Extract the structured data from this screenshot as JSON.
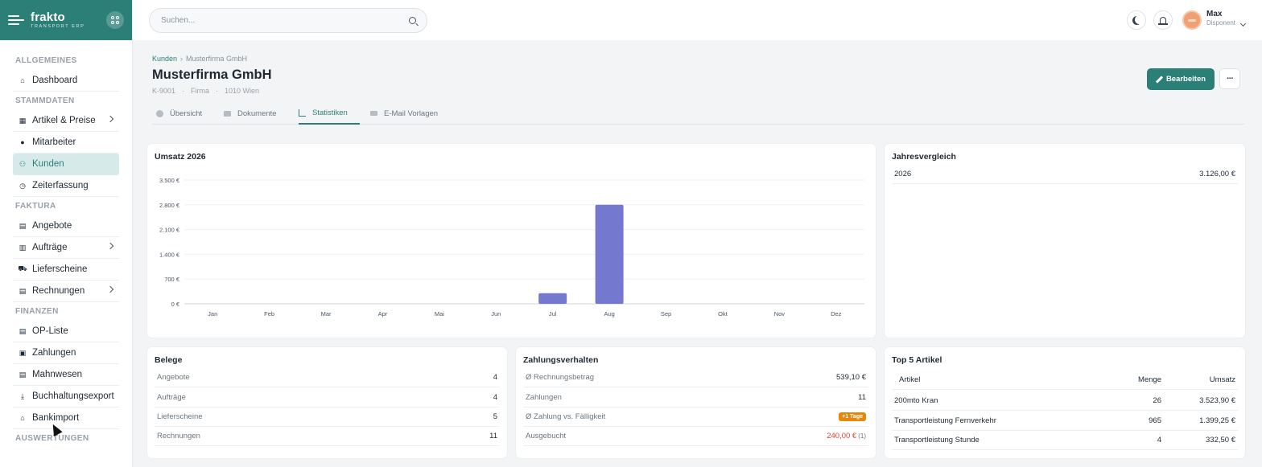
{
  "brand": {
    "name": "frakto",
    "tagline": "TRANSPORT ERP"
  },
  "sidebar": {
    "sections": [
      {
        "title": "ALLGEMEINES",
        "items": [
          {
            "label": "Dashboard",
            "icon": "home-icon"
          }
        ]
      },
      {
        "title": "STAMMDATEN",
        "items": [
          {
            "label": "Artikel & Preise",
            "icon": "boxes-icon",
            "chevron": true
          },
          {
            "label": "Mitarbeiter",
            "icon": "user-icon"
          },
          {
            "label": "Kunden",
            "icon": "users-icon",
            "active": true
          },
          {
            "label": "Zeiterfassung",
            "icon": "clock-icon"
          }
        ]
      },
      {
        "title": "FAKTURA",
        "items": [
          {
            "label": "Angebote",
            "icon": "file-icon"
          },
          {
            "label": "Aufträge",
            "icon": "clipboard-icon",
            "chevron": true
          },
          {
            "label": "Lieferscheine",
            "icon": "truck-icon"
          },
          {
            "label": "Rechnungen",
            "icon": "invoice-icon",
            "chevron": true
          }
        ]
      },
      {
        "title": "FINANZEN",
        "items": [
          {
            "label": "OP-Liste",
            "icon": "list-icon"
          },
          {
            "label": "Zahlungen",
            "icon": "money-icon"
          },
          {
            "label": "Mahnwesen",
            "icon": "file-warning-icon"
          },
          {
            "label": "Buchhaltungsexport",
            "icon": "download-icon"
          },
          {
            "label": "Bankimport",
            "icon": "bank-icon"
          }
        ]
      },
      {
        "title": "AUSWERTUNGEN",
        "items": []
      }
    ]
  },
  "topbar": {
    "search_placeholder": "Suchen...",
    "user_name": "Max",
    "user_role": "Disponent"
  },
  "breadcrumb": {
    "parent": "Kunden",
    "current": "Musterfirma GmbH"
  },
  "page": {
    "title": "Musterfirma GmbH",
    "customer_no": "K-9001",
    "type": "Firma",
    "location": "1010 Wien",
    "edit_label": "Bearbeiten",
    "more_label": "···"
  },
  "tabs": [
    {
      "label": "Übersicht",
      "icon": "info-icon"
    },
    {
      "label": "Dokumente",
      "icon": "folder-icon"
    },
    {
      "label": "Statistiken",
      "icon": "chart-icon",
      "active": true
    },
    {
      "label": "E-Mail Vorlagen",
      "icon": "mail-icon"
    }
  ],
  "revenue_card": {
    "title": "Umsatz 2026"
  },
  "chart_data": {
    "type": "bar",
    "title": "Umsatz 2026",
    "categories": [
      "Jan",
      "Feb",
      "Mar",
      "Apr",
      "Mai",
      "Jun",
      "Jul",
      "Aug",
      "Sep",
      "Okt",
      "Nov",
      "Dez"
    ],
    "values": [
      0,
      0,
      0,
      0,
      0,
      0,
      300,
      2800,
      0,
      0,
      0,
      0
    ],
    "yticks": [
      0,
      700,
      1400,
      2100,
      2800,
      3500
    ],
    "ytick_labels": [
      "0 €",
      "700 €",
      "1.400 €",
      "2.100 €",
      "2.800 €",
      "3.500 €"
    ],
    "ylim": [
      0,
      3500
    ],
    "xlabel": "",
    "ylabel": "",
    "grid": true,
    "bar_color": "#7479cf"
  },
  "year_compare": {
    "title": "Jahresvergleich",
    "rows": [
      {
        "year": "2026",
        "value": "3.126,00 €"
      }
    ]
  },
  "belege": {
    "title": "Belege",
    "rows": [
      {
        "label": "Angebote",
        "value": "4"
      },
      {
        "label": "Aufträge",
        "value": "4"
      },
      {
        "label": "Lieferscheine",
        "value": "5"
      },
      {
        "label": "Rechnungen",
        "value": "11"
      }
    ]
  },
  "payment": {
    "title": "Zahlungsverhalten",
    "avg_invoice_label": "Ø Rechnungsbetrag",
    "avg_invoice_value": "539,10 €",
    "payments_label": "Zahlungen",
    "payments_value": "11",
    "avg_delay_label": "Ø Zahlung vs. Fälligkeit",
    "avg_delay_badge": "+1 Tage",
    "outstanding_label": "Ausgebucht",
    "outstanding_value": "240,00 €",
    "outstanding_count": "(1)"
  },
  "top_articles": {
    "title": "Top 5 Artikel",
    "headers": {
      "article": "Artikel",
      "qty": "Menge",
      "revenue": "Umsatz"
    },
    "rows": [
      {
        "name": "200mto Kran",
        "qty": "26",
        "revenue": "3.523,90 €"
      },
      {
        "name": "Transportleistung Fernverkehr",
        "qty": "965",
        "revenue": "1.399,25 €"
      },
      {
        "name": "Transportleistung Stunde",
        "qty": "4",
        "revenue": "332,50 €"
      }
    ]
  },
  "colors": {
    "accent": "#2b7f76",
    "bar": "#7479cf",
    "warning": "#e8860c",
    "danger": "#e0452d"
  }
}
